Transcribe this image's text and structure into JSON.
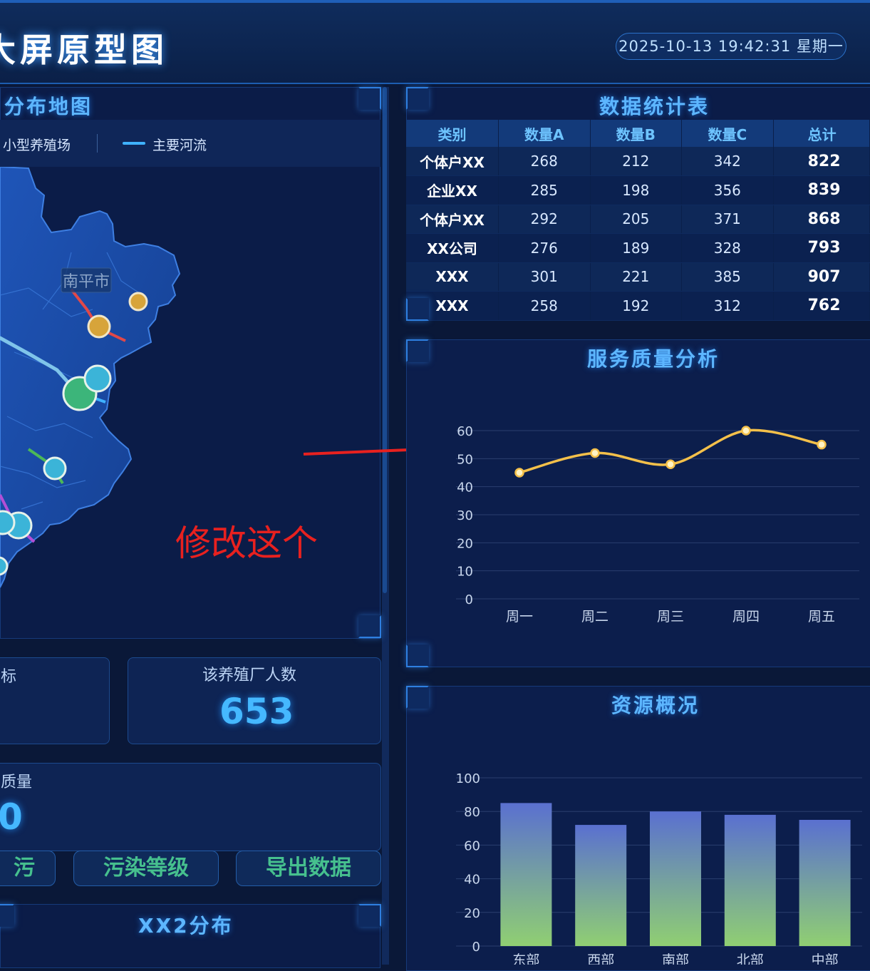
{
  "header": {
    "title": "大屏原型图",
    "datetime": "2025-10-13 19:42:31 星期一"
  },
  "map_panel": {
    "title": "分布地图",
    "legend": [
      {
        "label": "小型养殖场",
        "icon": "circle-icon"
      },
      {
        "label": "主要河流",
        "icon": "line-icon"
      }
    ],
    "city_label": "南平市",
    "annotation": "修改这个"
  },
  "stats": {
    "box1_label": "标",
    "box2_label": "该养殖厂人数",
    "box2_value": "653",
    "box3_label": "质量",
    "box3_value": "0"
  },
  "buttons": {
    "b1": "污",
    "b2": "污染等级",
    "b3": "导出数据"
  },
  "bottom_left_panel": {
    "title": "XX2分布"
  },
  "table_panel": {
    "title": "数据统计表",
    "columns": [
      "类别",
      "数量A",
      "数量B",
      "数量C",
      "总计"
    ],
    "rows": [
      [
        "个体户XX",
        "268",
        "212",
        "342",
        "822"
      ],
      [
        "企业XX",
        "285",
        "198",
        "356",
        "839"
      ],
      [
        "个体户XX",
        "292",
        "205",
        "371",
        "868"
      ],
      [
        "XX公司",
        "276",
        "189",
        "328",
        "793"
      ],
      [
        "XXX",
        "301",
        "221",
        "385",
        "907"
      ],
      [
        "XXX",
        "258",
        "192",
        "312",
        "762"
      ]
    ]
  },
  "line_panel": {
    "title": "服务质量分析",
    "chart_data": {
      "type": "line",
      "categories": [
        "周一",
        "周二",
        "周三",
        "周四",
        "周五"
      ],
      "series": [
        {
          "values": [
            45,
            52,
            48,
            60,
            55
          ],
          "color": "#f4c04a"
        }
      ],
      "ylim": [
        0,
        60
      ],
      "yticks": [
        0,
        10,
        20,
        30,
        40,
        50,
        60
      ],
      "grid": true,
      "smooth": true
    }
  },
  "bar_panel": {
    "title": "资源概况",
    "chart_data": {
      "type": "bar",
      "categories": [
        "东部",
        "西部",
        "南部",
        "北部",
        "中部"
      ],
      "values": [
        85,
        72,
        80,
        78,
        75
      ],
      "ylim": [
        0,
        100
      ],
      "yticks": [
        0,
        20,
        40,
        60,
        80,
        100
      ],
      "grid": true,
      "gradient": [
        "#5a70d0",
        "#90cf72"
      ]
    }
  }
}
